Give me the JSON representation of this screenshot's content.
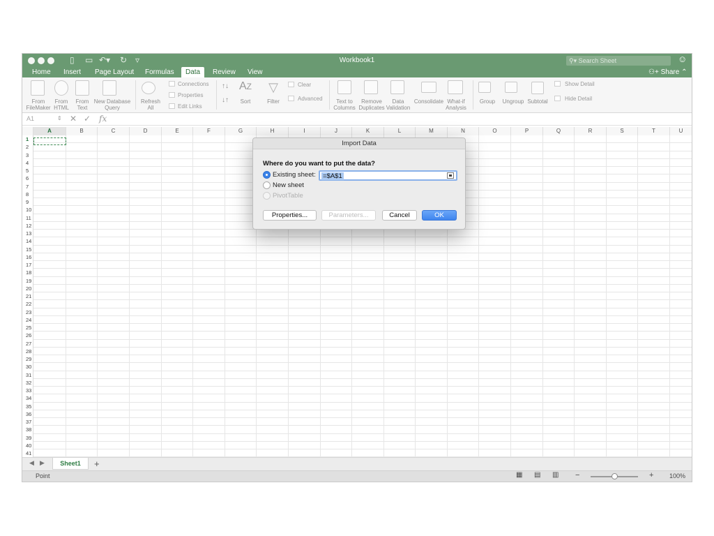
{
  "window": {
    "title": "Workbook1"
  },
  "titlebar": {
    "search_placeholder": "Search Sheet",
    "share_label": "Share"
  },
  "tabs": [
    {
      "label": "Home"
    },
    {
      "label": "Insert"
    },
    {
      "label": "Page Layout"
    },
    {
      "label": "Formulas"
    },
    {
      "label": "Data"
    },
    {
      "label": "Review"
    },
    {
      "label": "View"
    }
  ],
  "ribbon": {
    "from_filemaker_1": "From",
    "from_filemaker_2": "FileMaker",
    "from_html_1": "From",
    "from_html_2": "HTML",
    "from_text_1": "From",
    "from_text_2": "Text",
    "new_db_query_1": "New Database",
    "new_db_query_2": "Query",
    "refresh_all_1": "Refresh",
    "refresh_all_2": "All",
    "connections": "Connections",
    "properties": "Properties",
    "edit_links": "Edit Links",
    "sort": "Sort",
    "filter": "Filter",
    "clear": "Clear",
    "advanced": "Advanced",
    "text_to_columns_1": "Text to",
    "text_to_columns_2": "Columns",
    "remove_duplicates_1": "Remove",
    "remove_duplicates_2": "Duplicates",
    "data_validation_1": "Data",
    "data_validation_2": "Validation",
    "consolidate": "Consolidate",
    "what_if_1": "What-if",
    "what_if_2": "Analysis",
    "group": "Group",
    "ungroup": "Ungroup",
    "subtotal": "Subtotal",
    "show_detail": "Show Detail",
    "hide_detail": "Hide Detail"
  },
  "formula_bar": {
    "name_box": "A1",
    "fx": "fx"
  },
  "columns": [
    "A",
    "B",
    "C",
    "D",
    "E",
    "F",
    "G",
    "H",
    "I",
    "J",
    "K",
    "L",
    "M",
    "N",
    "O",
    "P",
    "Q",
    "R",
    "S",
    "T",
    "U"
  ],
  "rows": [
    "1",
    "2",
    "3",
    "4",
    "5",
    "6",
    "7",
    "8",
    "9",
    "10",
    "11",
    "12",
    "13",
    "14",
    "15",
    "16",
    "17",
    "18",
    "19",
    "20",
    "21",
    "22",
    "23",
    "24",
    "25",
    "26",
    "27",
    "28",
    "29",
    "30",
    "31",
    "32",
    "33",
    "34",
    "35",
    "36",
    "37",
    "38",
    "39",
    "40",
    "41"
  ],
  "sheet_tabs": {
    "active": "Sheet1",
    "add": "+"
  },
  "status": {
    "mode": "Point",
    "zoom": "100%",
    "zoom_minus": "−",
    "zoom_plus": "+"
  },
  "dialog": {
    "title": "Import Data",
    "question": "Where do you want to put the data?",
    "existing_sheet": "Existing sheet:",
    "existing_ref": "=$A$1",
    "new_sheet": "New sheet",
    "pivot_table": "PivotTable",
    "properties_btn": "Properties...",
    "parameters_btn": "Parameters...",
    "cancel_btn": "Cancel",
    "ok_btn": "OK"
  }
}
